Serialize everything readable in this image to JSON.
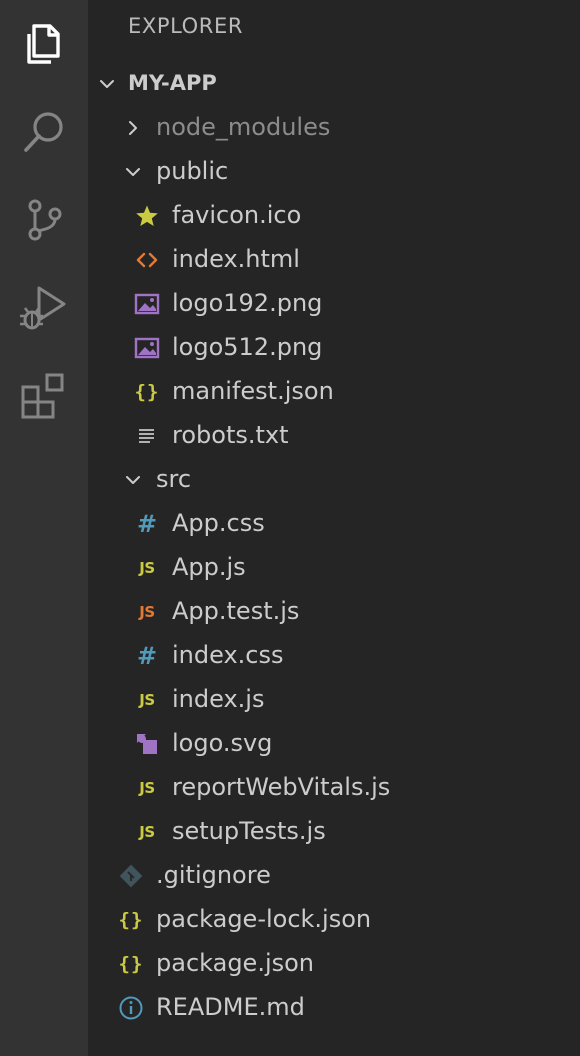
{
  "sidebar": {
    "title": "EXPLORER",
    "section": {
      "label": "MY-APP",
      "expanded": true
    }
  },
  "activity_bar": {
    "items": [
      {
        "icon": "files-icon",
        "active": true
      },
      {
        "icon": "search-icon",
        "active": false
      },
      {
        "icon": "source-control-icon",
        "active": false
      },
      {
        "icon": "run-debug-icon",
        "active": false
      },
      {
        "icon": "extensions-icon",
        "active": false
      }
    ]
  },
  "tree": {
    "items": [
      {
        "label": "node_modules",
        "kind": "folder",
        "depth": 1,
        "expanded": false,
        "dim": true
      },
      {
        "label": "public",
        "kind": "folder",
        "depth": 1,
        "expanded": true
      },
      {
        "label": "favicon.ico",
        "kind": "file",
        "depth": 2,
        "icon": "star-icon",
        "color": "#cbcb41"
      },
      {
        "label": "index.html",
        "kind": "file",
        "depth": 2,
        "icon": "html-icon",
        "color": "#e37933"
      },
      {
        "label": "logo192.png",
        "kind": "file",
        "depth": 2,
        "icon": "image-icon",
        "color": "#a074c4"
      },
      {
        "label": "logo512.png",
        "kind": "file",
        "depth": 2,
        "icon": "image-icon",
        "color": "#a074c4"
      },
      {
        "label": "manifest.json",
        "kind": "file",
        "depth": 2,
        "icon": "json-icon",
        "color": "#cbcb41"
      },
      {
        "label": "robots.txt",
        "kind": "file",
        "depth": 2,
        "icon": "text-lines-icon",
        "color": "#c5c5c5"
      },
      {
        "label": "src",
        "kind": "folder",
        "depth": 1,
        "expanded": true
      },
      {
        "label": "App.css",
        "kind": "file",
        "depth": 2,
        "icon": "css-icon",
        "color": "#519aba"
      },
      {
        "label": "App.js",
        "kind": "file",
        "depth": 2,
        "icon": "js-icon",
        "color": "#cbcb41"
      },
      {
        "label": "App.test.js",
        "kind": "file",
        "depth": 2,
        "icon": "js-test-icon",
        "color": "#e37933"
      },
      {
        "label": "index.css",
        "kind": "file",
        "depth": 2,
        "icon": "css-icon",
        "color": "#519aba"
      },
      {
        "label": "index.js",
        "kind": "file",
        "depth": 2,
        "icon": "js-icon",
        "color": "#cbcb41"
      },
      {
        "label": "logo.svg",
        "kind": "file",
        "depth": 2,
        "icon": "svg-icon",
        "color": "#a074c4"
      },
      {
        "label": "reportWebVitals.js",
        "kind": "file",
        "depth": 2,
        "icon": "js-icon",
        "color": "#cbcb41"
      },
      {
        "label": "setupTests.js",
        "kind": "file",
        "depth": 2,
        "icon": "js-icon",
        "color": "#cbcb41"
      },
      {
        "label": ".gitignore",
        "kind": "file",
        "depth": 1,
        "icon": "git-icon",
        "color": "#41535b"
      },
      {
        "label": "package-lock.json",
        "kind": "file",
        "depth": 1,
        "icon": "json-icon",
        "color": "#cbcb41"
      },
      {
        "label": "package.json",
        "kind": "file",
        "depth": 1,
        "icon": "json-icon",
        "color": "#cbcb41"
      },
      {
        "label": "README.md",
        "kind": "file",
        "depth": 1,
        "icon": "info-icon",
        "color": "#519aba"
      }
    ]
  },
  "colors": {
    "activity_bar_bg": "#333333",
    "sidebar_bg": "#252526",
    "text": "#cccccc",
    "dim_text": "#8c8c8c"
  }
}
